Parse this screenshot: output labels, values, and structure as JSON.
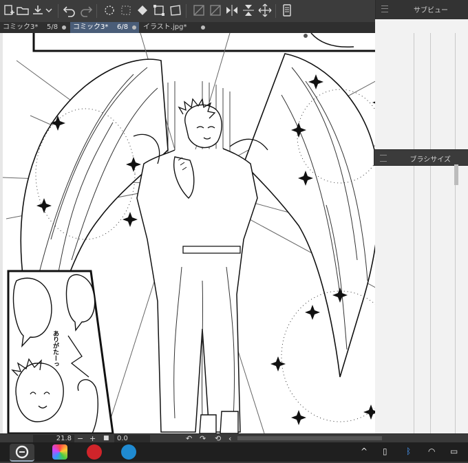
{
  "panels": {
    "subview": "サブビュー",
    "brush_size": "ブラシサイズ"
  },
  "tabs": [
    {
      "name": "コミック3*",
      "page": "5/8",
      "active": false
    },
    {
      "name": "コミック3*",
      "page": "6/8",
      "active": true
    },
    {
      "name": "イラスト.jpg*",
      "page": "",
      "active": false
    }
  ],
  "canvas": {
    "speech_text": "ありがたーっ"
  },
  "status": {
    "zoom": "21.8",
    "angle": "0.0",
    "minus": "−",
    "plus": "+"
  },
  "colors": {
    "accent_tab": "#4a5d78",
    "panel_bg": "#3c3c3c",
    "taskbar_bg": "#1f1f1f"
  }
}
